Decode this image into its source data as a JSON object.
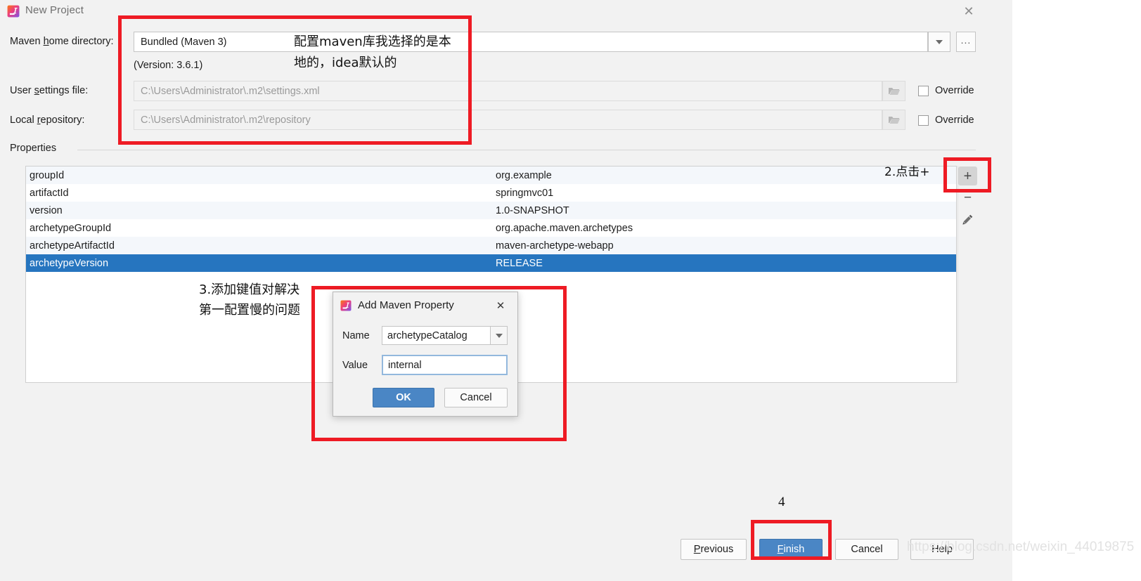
{
  "window": {
    "title": "New Project",
    "icon": "intellij-idea-icon",
    "close_label": "✕"
  },
  "form": {
    "maven_home": {
      "label_pre": "Maven ",
      "label_accel": "h",
      "label_post": "ome directory:",
      "value": "Bundled (Maven 3)",
      "version_note": "(Version: 3.6.1)",
      "dropdown_icon": "chevron-down-icon",
      "browse_label": "..."
    },
    "user_settings": {
      "label_pre": "User ",
      "label_accel": "s",
      "label_post": "ettings file:",
      "value": "C:\\Users\\Administrator\\.m2\\settings.xml",
      "folder_icon": "folder-icon",
      "override_label": "Override"
    },
    "local_repository": {
      "label_pre": "Local ",
      "label_accel": "r",
      "label_post": "epository:",
      "value": "C:\\Users\\Administrator\\.m2\\repository",
      "folder_icon": "folder-icon",
      "override_label": "Override"
    }
  },
  "properties": {
    "group_title": "Properties",
    "rows": [
      {
        "key": "groupId",
        "value": "org.example"
      },
      {
        "key": "artifactId",
        "value": "springmvc01"
      },
      {
        "key": "version",
        "value": "1.0-SNAPSHOT"
      },
      {
        "key": "archetypeGroupId",
        "value": "org.apache.maven.archetypes"
      },
      {
        "key": "archetypeArtifactId",
        "value": "maven-archetype-webapp"
      },
      {
        "key": "archetypeVersion",
        "value": "RELEASE"
      }
    ],
    "selected_index": 5,
    "toolbar": {
      "add_label": "+",
      "remove_label": "−",
      "edit_icon": "pencil-icon"
    }
  },
  "modal": {
    "title": "Add Maven Property",
    "icon": "intellij-idea-icon",
    "close_label": "✕",
    "name_label": "Name",
    "name_value": "archetypeCatalog",
    "name_dropdown_icon": "chevron-down-icon",
    "value_label": "Value",
    "value_value": "internal",
    "ok_label": "OK",
    "cancel_label": "Cancel"
  },
  "footer": {
    "previous_pre": "",
    "previous_accel": "P",
    "previous_post": "revious",
    "finish_pre": "",
    "finish_accel": "F",
    "finish_post": "inish",
    "cancel_label": "Cancel",
    "help_label": "Help"
  },
  "annotations": {
    "note_maven_line1": "配置maven库我选择的是本",
    "note_maven_line2": "地的，idea默认的",
    "note_click_plus": "2.点击+",
    "note_add_kv_line1": "3.添加键值对解决",
    "note_add_kv_line2": "第一配置慢的问题",
    "note_four": "4",
    "highlight_color": "#ee1b24"
  },
  "watermark": {
    "text": "https://blog.csdn.net/weixin_44019875"
  }
}
